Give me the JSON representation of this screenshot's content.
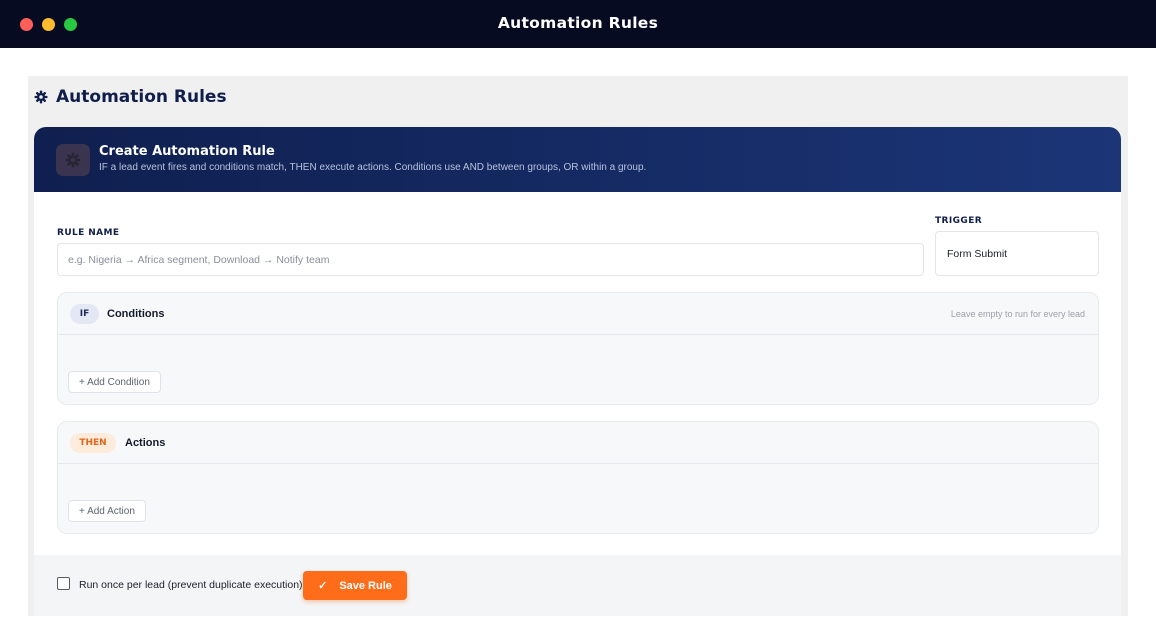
{
  "window": {
    "title": "Automation Rules"
  },
  "page": {
    "title": "Automation Rules"
  },
  "card": {
    "title": "Create Automation Rule",
    "subtitle": "IF a lead event fires and conditions match, THEN execute actions. Conditions use AND between groups, OR within a group."
  },
  "form": {
    "rule_name_label": "RULE NAME",
    "rule_name_placeholder": "e.g. Nigeria → Africa segment, Download → Notify team",
    "rule_name_value": "",
    "trigger_label": "TRIGGER",
    "trigger_value": "Form Submit"
  },
  "conditions": {
    "badge": "IF",
    "title": "Conditions",
    "hint": "Leave empty to run for every lead",
    "add_label": "+ Add Condition"
  },
  "actions": {
    "badge": "THEN",
    "title": "Actions",
    "add_label": "+ Add Action"
  },
  "footer": {
    "run_once_label": "Run once per lead (prevent duplicate execution)",
    "run_once_checked": false,
    "save_label": "Save Rule",
    "save_icon": "✓"
  },
  "colors": {
    "titlebar": "#070b22",
    "header_start": "#0f1f4f",
    "header_end": "#1b3577",
    "accent": "#ff6c1a",
    "navy_text": "#0f1e4a"
  }
}
